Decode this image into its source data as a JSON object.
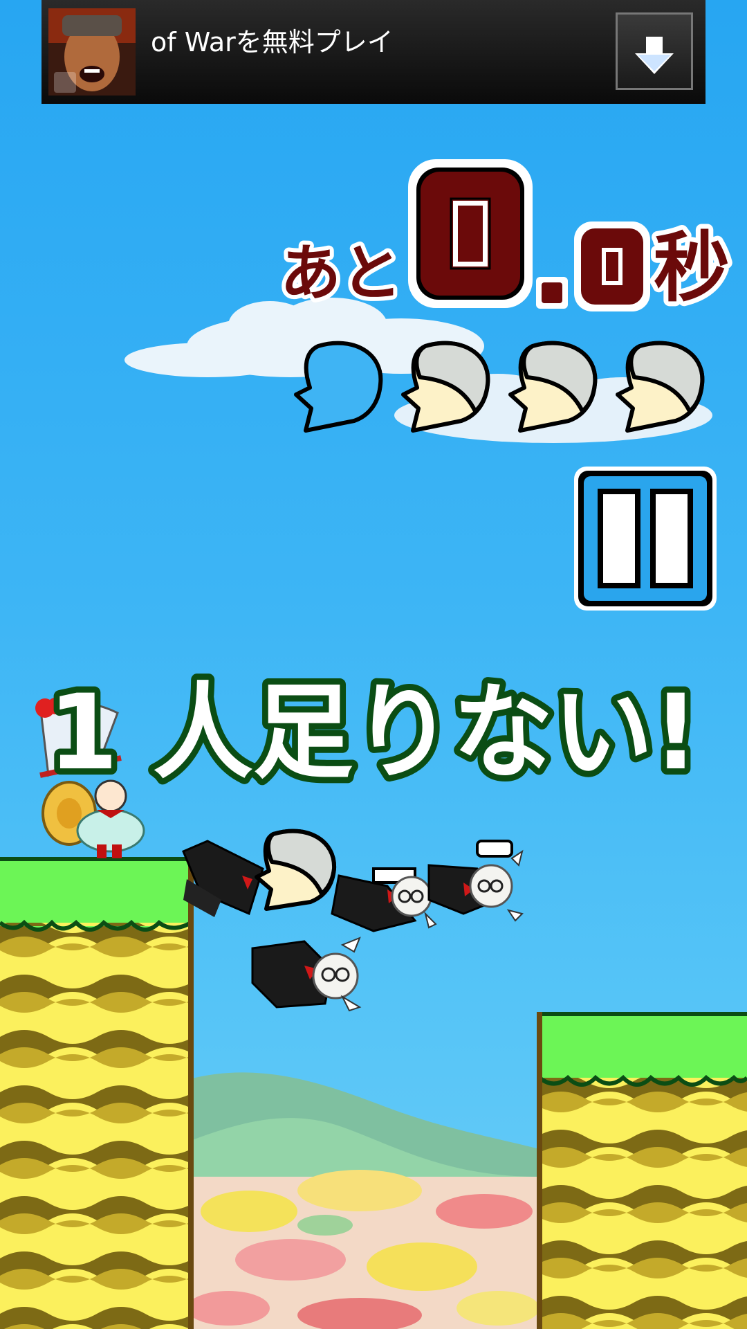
{
  "ad": {
    "text": "of Warを無料プレイ",
    "thumb_icon": "warrior-portrait-icon",
    "download_icon": "download-arrow-icon"
  },
  "timer": {
    "prefix": "あと",
    "seconds_int": "0",
    "dot": ".",
    "seconds_dec": "0",
    "suffix": "秒"
  },
  "heads": {
    "total": 4,
    "filled": 3,
    "icon": "head-icon"
  },
  "pause": {
    "icon": "pause-icon"
  },
  "banner": {
    "text": "1 人足りない!"
  },
  "colors": {
    "timer_fill": "#6b0a0a",
    "banner_outline": "#0b4d14",
    "grass": "#6cf556",
    "stripe_a": "#fbf05d",
    "stripe_b": "#7d6a15",
    "pause_blue": "#2aa5ed"
  }
}
